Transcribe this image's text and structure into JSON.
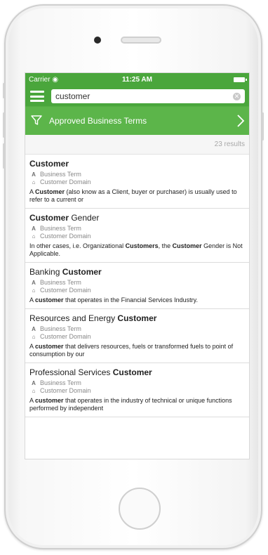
{
  "status_bar": {
    "carrier": "Carrier ◉",
    "time": "11:25 AM"
  },
  "search": {
    "value": "customer"
  },
  "filter": {
    "label": "Approved Business Terms"
  },
  "results": {
    "count_text": "23 results"
  },
  "meta_labels": {
    "type": "Business Term",
    "domain": "Customer Domain"
  },
  "cards": [
    {
      "title": [
        {
          "t": "Customer",
          "b": true
        }
      ],
      "desc": [
        {
          "t": "A ",
          "b": false
        },
        {
          "t": "Customer",
          "b": true
        },
        {
          "t": " (also know as a Client, buyer or purchaser) is usually used to refer to a current or",
          "b": false
        }
      ]
    },
    {
      "title": [
        {
          "t": "Customer",
          "b": true
        },
        {
          "t": " Gender",
          "b": false
        }
      ],
      "desc": [
        {
          "t": "In other cases, i.e. Organizational ",
          "b": false
        },
        {
          "t": "Customers",
          "b": true
        },
        {
          "t": ", the ",
          "b": false
        },
        {
          "t": "Customer",
          "b": true
        },
        {
          "t": " Gender is Not Applicable.",
          "b": false
        }
      ]
    },
    {
      "title": [
        {
          "t": "Banking ",
          "b": false
        },
        {
          "t": "Customer",
          "b": true
        }
      ],
      "desc": [
        {
          "t": "A ",
          "b": false
        },
        {
          "t": "customer",
          "b": true
        },
        {
          "t": " that operates in the Financial Services Industry.",
          "b": false
        }
      ]
    },
    {
      "title": [
        {
          "t": "Resources and Energy ",
          "b": false
        },
        {
          "t": "Customer",
          "b": true
        }
      ],
      "desc": [
        {
          "t": "A ",
          "b": false
        },
        {
          "t": "customer",
          "b": true
        },
        {
          "t": " that delivers resources, fuels or transformed fuels to point of consumption by our",
          "b": false
        }
      ]
    },
    {
      "title": [
        {
          "t": "Professional Services ",
          "b": false
        },
        {
          "t": "Customer",
          "b": true
        }
      ],
      "desc": [
        {
          "t": "A ",
          "b": false
        },
        {
          "t": "customer",
          "b": true
        },
        {
          "t": " that operates in the industry of technical or unique functions performed by independent",
          "b": false
        }
      ]
    }
  ],
  "colors": {
    "header_green": "#4aa63c",
    "filter_green": "#5cb54a"
  },
  "icons": {
    "menu": "hamburger-icon",
    "clear": "clear-icon",
    "filter": "filter-icon",
    "next": "chevron-right-icon",
    "type": "business-term-icon",
    "domain": "domain-icon"
  }
}
